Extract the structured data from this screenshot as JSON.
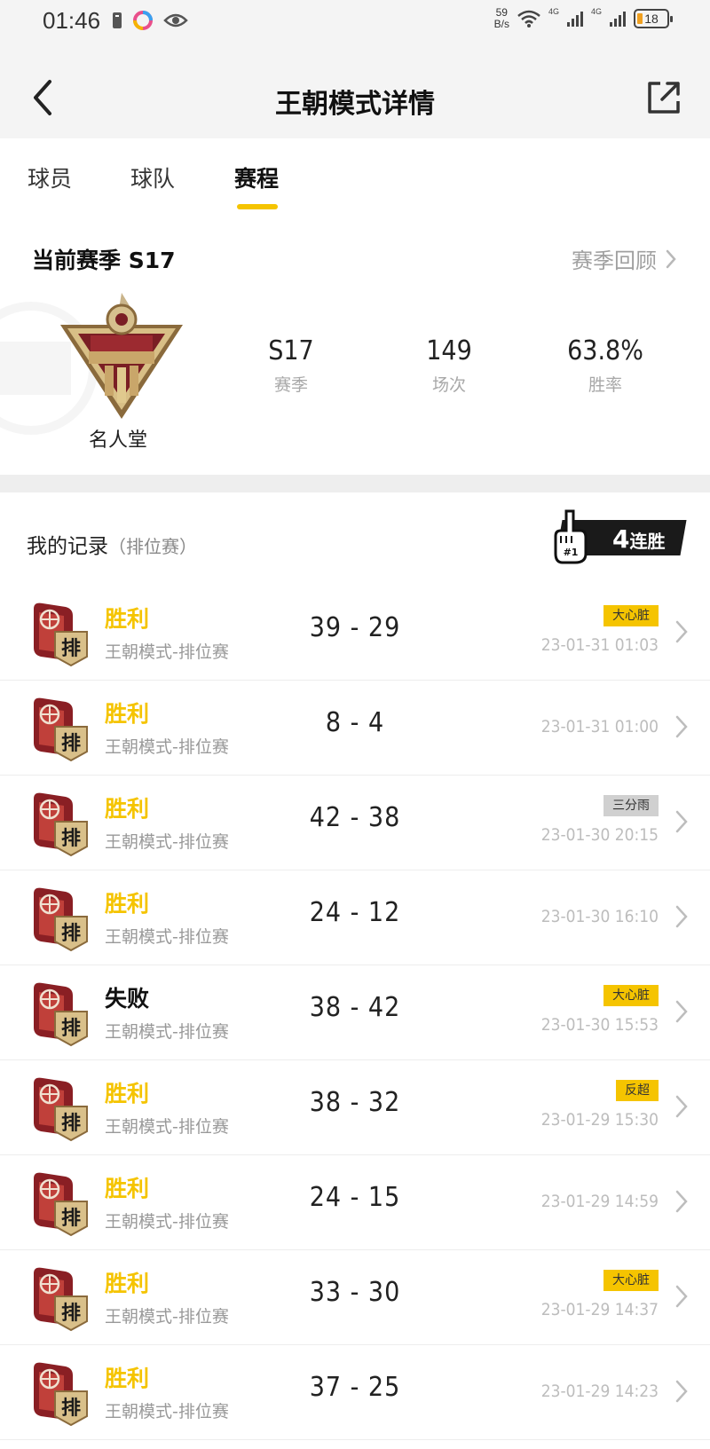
{
  "status_bar": {
    "time": "01:46",
    "net_speed_value": "59",
    "net_speed_unit": "B/s",
    "signal_1": "4G",
    "signal_2": "4G",
    "battery": "18"
  },
  "header": {
    "title": "王朝模式详情",
    "back_icon": "chevron-left-icon",
    "share_icon": "share-icon"
  },
  "tabs": [
    {
      "label": "球员",
      "active": false
    },
    {
      "label": "球队",
      "active": false
    },
    {
      "label": "赛程",
      "active": true
    }
  ],
  "colors": {
    "accent": "#f5c400",
    "tag_gray": "#d0d0d0"
  },
  "season": {
    "title": "当前赛季 S17",
    "review_link": "赛季回顾",
    "rank_name": "名人堂",
    "stats": [
      {
        "value": "S17",
        "label": "赛季"
      },
      {
        "value": "149",
        "label": "场次"
      },
      {
        "value": "63.8%",
        "label": "胜率"
      }
    ]
  },
  "records": {
    "title": "我的记录",
    "subtitle": "（排位赛）",
    "streak_number": "4",
    "streak_text": "连胜",
    "badge_label": "#1",
    "icon_glyph": "排",
    "items": [
      {
        "result": "胜利",
        "win": true,
        "mode": "王朝模式-排位赛",
        "score": "39 - 29",
        "tag": "大心脏",
        "tag_style": "gold",
        "time": "23-01-31 01:03"
      },
      {
        "result": "胜利",
        "win": true,
        "mode": "王朝模式-排位赛",
        "score": "8 - 4",
        "tag": "",
        "tag_style": "",
        "time": "23-01-31 01:00"
      },
      {
        "result": "胜利",
        "win": true,
        "mode": "王朝模式-排位赛",
        "score": "42 - 38",
        "tag": "三分雨",
        "tag_style": "gray",
        "time": "23-01-30 20:15"
      },
      {
        "result": "胜利",
        "win": true,
        "mode": "王朝模式-排位赛",
        "score": "24 - 12",
        "tag": "",
        "tag_style": "",
        "time": "23-01-30 16:10"
      },
      {
        "result": "失败",
        "win": false,
        "mode": "王朝模式-排位赛",
        "score": "38 - 42",
        "tag": "大心脏",
        "tag_style": "gold",
        "time": "23-01-30 15:53"
      },
      {
        "result": "胜利",
        "win": true,
        "mode": "王朝模式-排位赛",
        "score": "38 - 32",
        "tag": "反超",
        "tag_style": "gold",
        "time": "23-01-29 15:30"
      },
      {
        "result": "胜利",
        "win": true,
        "mode": "王朝模式-排位赛",
        "score": "24 - 15",
        "tag": "",
        "tag_style": "",
        "time": "23-01-29 14:59"
      },
      {
        "result": "胜利",
        "win": true,
        "mode": "王朝模式-排位赛",
        "score": "33 - 30",
        "tag": "大心脏",
        "tag_style": "gold",
        "time": "23-01-29 14:37"
      },
      {
        "result": "胜利",
        "win": true,
        "mode": "王朝模式-排位赛",
        "score": "37 - 25",
        "tag": "",
        "tag_style": "",
        "time": "23-01-29 14:23"
      }
    ]
  }
}
